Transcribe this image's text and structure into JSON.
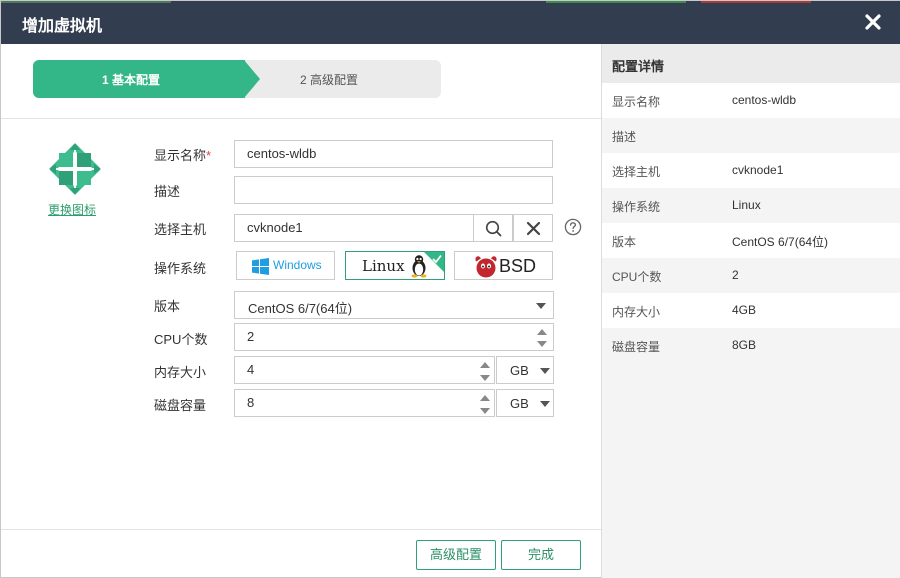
{
  "dialog": {
    "title": "增加虚拟机"
  },
  "steps": {
    "step1": "1 基本配置",
    "step2": "2 高级配置"
  },
  "icon_picker": {
    "link_label": "更换图标"
  },
  "form": {
    "display_name": {
      "label": "显示名称",
      "required_mark": "*",
      "value": "centos-wldb"
    },
    "description": {
      "label": "描述",
      "value": ""
    },
    "host": {
      "label": "选择主机",
      "value": "cvknode1"
    },
    "os": {
      "label": "操作系统",
      "options": [
        "Windows",
        "Linux",
        "BSD"
      ],
      "selected": "Linux"
    },
    "version": {
      "label": "版本",
      "value": "CentOS 6/7(64位)"
    },
    "cpu": {
      "label": "CPU个数",
      "value": "2"
    },
    "memory": {
      "label": "内存大小",
      "value": "4",
      "unit": "GB"
    },
    "disk": {
      "label": "磁盘容量",
      "value": "8",
      "unit": "GB"
    }
  },
  "footer": {
    "advanced_button": "高级配置",
    "finish_button": "完成"
  },
  "details": {
    "title": "配置详情",
    "rows": [
      {
        "key": "显示名称",
        "value": "centos-wldb"
      },
      {
        "key": "描述",
        "value": ""
      },
      {
        "key": "选择主机",
        "value": "cvknode1"
      },
      {
        "key": "操作系统",
        "value": "Linux"
      },
      {
        "key": "版本",
        "value": "CentOS 6/7(64位)"
      },
      {
        "key": "CPU个数",
        "value": "2"
      },
      {
        "key": "内存大小",
        "value": "4GB"
      },
      {
        "key": "磁盘容量",
        "value": "8GB"
      }
    ]
  },
  "colors": {
    "titlebar": "#323d4f",
    "accent": "#33b788",
    "link": "#2c9d6e",
    "windows": "#1e9ee0",
    "bsd": "#c2262e"
  },
  "icons": [
    "close-icon",
    "search-icon",
    "clear-icon",
    "help-icon",
    "centos-logo-icon",
    "windows-logo-icon",
    "linux-tux-icon",
    "bsd-daemon-icon",
    "checkmark-icon",
    "chevron-down-icon",
    "spinner-up-icon",
    "spinner-down-icon"
  ]
}
